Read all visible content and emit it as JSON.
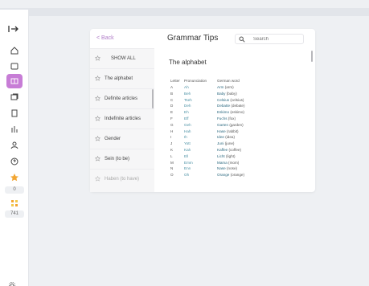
{
  "app": {
    "logo_text": "|->"
  },
  "card": {
    "back_label": "< Back",
    "title": "Grammar Tips",
    "search_placeholder": "Search"
  },
  "sidebar": {
    "items": [
      {
        "label": "SHOW ALL"
      },
      {
        "label": "The alphabet"
      },
      {
        "label": "Definite articles"
      },
      {
        "label": "Indefinite articles"
      },
      {
        "label": "Gender"
      },
      {
        "label": "Sein (to be)"
      },
      {
        "label": "Haben (to have)"
      }
    ]
  },
  "rail": {
    "level_value": "0",
    "score_value": "741"
  },
  "content": {
    "section_title": "The alphabet",
    "table": {
      "headers": [
        "Letter",
        "Pronunciation",
        "German word"
      ],
      "rows": [
        {
          "letter": "A",
          "pron": "Ah",
          "word": "Arm",
          "trans": "(arm)"
        },
        {
          "letter": "B",
          "pron": "Beh",
          "word": "Baby",
          "trans": "(baby)"
        },
        {
          "letter": "C",
          "pron": "Tseh",
          "word": "Celsius",
          "trans": "(celsius)"
        },
        {
          "letter": "D",
          "pron": "Deh",
          "word": "Debatte",
          "trans": "(debate)"
        },
        {
          "letter": "E",
          "pron": "Eh",
          "word": "Eskimo",
          "trans": "(eskimo)"
        },
        {
          "letter": "F",
          "pron": "Eff",
          "word": "Fuchs",
          "trans": "(fox)"
        },
        {
          "letter": "G",
          "pron": "Geh",
          "word": "Garten",
          "trans": "(garden)"
        },
        {
          "letter": "H",
          "pron": "Hah",
          "word": "Hase",
          "trans": "(rabbit)"
        },
        {
          "letter": "I",
          "pron": "Ih",
          "word": "Idee",
          "trans": "(idea)"
        },
        {
          "letter": "J",
          "pron": "Yott",
          "word": "Juni",
          "trans": "(june)"
        },
        {
          "letter": "K",
          "pron": "Kah",
          "word": "Kaffee",
          "trans": "(coffee)"
        },
        {
          "letter": "L",
          "pron": "Ell",
          "word": "Licht",
          "trans": "(light)"
        },
        {
          "letter": "M",
          "pron": "Emm",
          "word": "Mama",
          "trans": "(mom)"
        },
        {
          "letter": "N",
          "pron": "Enn",
          "word": "Nase",
          "trans": "(nose)"
        },
        {
          "letter": "O",
          "pron": "Oh",
          "word": "Orange",
          "trans": "(orange)"
        }
      ]
    }
  },
  "colors": {
    "accent": "#c77dd6",
    "link": "#4a90a4",
    "background": "#eef0f3"
  }
}
